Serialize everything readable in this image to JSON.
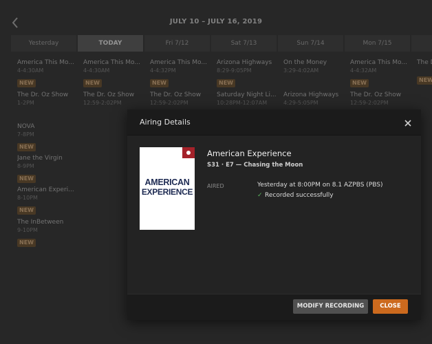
{
  "header": {
    "date_range": "JULY 10 – JULY 16, 2019"
  },
  "days": [
    "Yesterday",
    "TODAY",
    "Fri 7/12",
    "Sat 7/13",
    "Sun 7/14",
    "Mon 7/15",
    ""
  ],
  "programs": [
    {
      "title": "America This Mo...",
      "time": "4-4:30AM",
      "badge": "NEW"
    },
    {
      "title": "The Dr. Oz Show",
      "time": "1-2PM",
      "badge": ""
    },
    {
      "title": "NOVA",
      "time": "7-8PM",
      "badge": "NEW"
    },
    {
      "title": "Jane the Virgin",
      "time": "8-9PM",
      "badge": "NEW"
    },
    {
      "title": "American Experi...",
      "time": "8-10PM",
      "badge": "NEW"
    },
    {
      "title": "The InBetween",
      "time": "9-10PM",
      "badge": "NEW"
    },
    {
      "title": "America This Mo...",
      "time": "4-4:30AM",
      "badge": "NEW"
    },
    {
      "title": "The Dr. Oz Show",
      "time": "12:59-2:02PM",
      "badge": ""
    },
    {
      "title": "America This Mo...",
      "time": "4-4:32PM",
      "badge": "NEW"
    },
    {
      "title": "The Dr. Oz Show",
      "time": "12:59-2:02PM",
      "badge": ""
    },
    {
      "title": "Arizona Highways",
      "time": "8:29-9:05PM",
      "badge": "NEW"
    },
    {
      "title": "Saturday Night Li...",
      "time": "10:28PM-12:07AM",
      "badge": ""
    },
    {
      "title": "On the Money",
      "time": "3:29-4:02AM",
      "badge": ""
    },
    {
      "title": "Arizona Highways",
      "time": "4:29-5:05PM",
      "badge": ""
    },
    {
      "title": "America This Mo...",
      "time": "4-4:32AM",
      "badge": "NEW"
    },
    {
      "title": "The Dr. Oz Show",
      "time": "12:59-2:02PM",
      "badge": ""
    },
    {
      "title": "The D",
      "time": "",
      "badge": "NEW"
    }
  ],
  "modal": {
    "title": "Airing Details",
    "show_title": "American Experience",
    "episode": "S31 · E7 — Chasing the Moon",
    "aired_label": "AIRED",
    "aired_value": "Yesterday at 8:00PM on 8.1 AZPBS (PBS)",
    "status_check": "✓",
    "status_text": "Recorded successfully",
    "poster_line1": "AMERICAN",
    "poster_line2": "EXPERIENCE",
    "modify_label": "MODIFY RECORDING",
    "close_label": "CLOSE"
  },
  "colors": {
    "accent": "#cc6a1e",
    "new_badge": "#6b5336",
    "record_red": "#a4222a",
    "success": "#5ab55e"
  },
  "icons": {
    "back": "chevron-left-icon",
    "close": "close-icon",
    "record": "record-dot-icon"
  }
}
